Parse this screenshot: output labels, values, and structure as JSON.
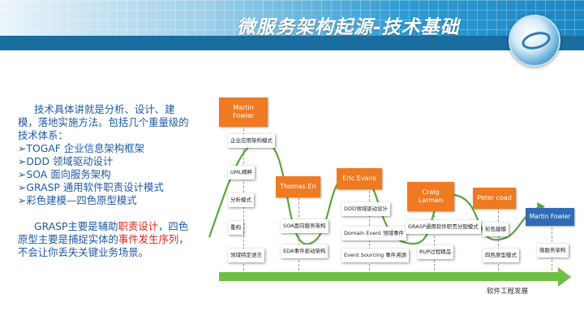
{
  "title": "微服务架构起源-技术基础",
  "left_text": {
    "intro": "技术具体讲就是分析、设计、建模，落地实施方法。包括几个重量级的技术体系：",
    "items": [
      "➢TOGAF 企业信息架构框架",
      "➢DDD 领域驱动设计",
      "➢SOA 面向服务架构",
      "➢GRASP 通用软件职责设计模式",
      "➢彩色建模—四色原型模式"
    ],
    "para2_a": "GRASP主要是辅助",
    "para2_hl1": "职责设计",
    "para2_b": "，四色原型主要是捕捉实体的",
    "para2_hl2": "事件发生序列",
    "para2_c": "，不会让你丢失关键业务场景。"
  },
  "timeline": {
    "axis_label": "软件工程发展",
    "people": [
      "Martin Fowler",
      "Thomas Erl",
      "Eric Evans",
      "Craig Larman",
      "Peter coad",
      "Martin Fowler"
    ],
    "col1": [
      "企业应用架构模式",
      "UML精粹",
      "分析模式",
      "重构",
      "领域特定语言"
    ],
    "col2": [
      "SOA面向服务架构",
      "EDA事件驱动架构"
    ],
    "col3": [
      "DDD领域驱动设计",
      "Domain Event 领域事件",
      "Event Sourcing 事件溯源"
    ],
    "col4": [
      "GRASP通用软件职责分配模式",
      "RUP过程精品"
    ],
    "col5": [
      "彩色建模",
      "四色原型模式"
    ],
    "col6": [
      "微服务架构"
    ]
  },
  "colors": {
    "orange": "#ef7a22",
    "blue": "#2f6cb5",
    "green": "#6fbf44",
    "wave": "#5aa63a",
    "text_blue": "#1f5aa6",
    "highlight_red": "#e3241f"
  }
}
